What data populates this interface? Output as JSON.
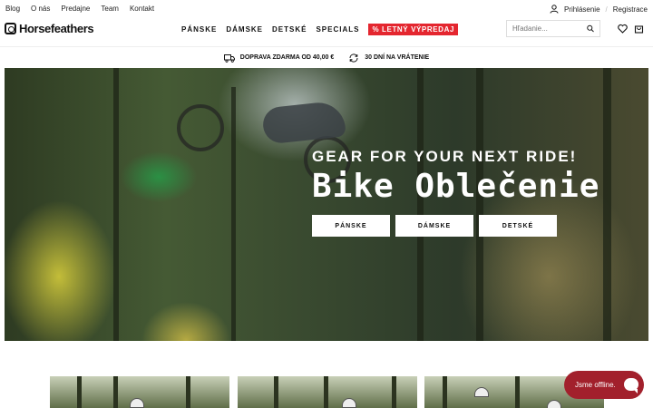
{
  "topbar": {
    "links": [
      "Blog",
      "O nás",
      "Predajne",
      "Team",
      "Kontakt"
    ],
    "login": "Prihlásenie",
    "register": "Registrace"
  },
  "header": {
    "brand": "Horsefeathers",
    "nav": [
      "PÁNSKE",
      "DÁMSKE",
      "DETSKÉ",
      "SPECIALS"
    ],
    "sale": "% LETNÝ VÝPREDAJ",
    "search_placeholder": "Hľadanie..."
  },
  "benefits": [
    "DOPRAVA ZDARMA OD 40,00 €",
    "30 DNÍ NA VRÁTENIE"
  ],
  "hero": {
    "subtitle": "GEAR FOR YOUR NEXT RIDE!",
    "title": "Bike Oblečenie",
    "buttons": [
      "PÁNSKE",
      "DÁMSKE",
      "DETSKÉ"
    ]
  },
  "chat": {
    "label": "Jsme offline."
  },
  "colors": {
    "sale": "#e4262f",
    "chat": "#a2202c"
  }
}
